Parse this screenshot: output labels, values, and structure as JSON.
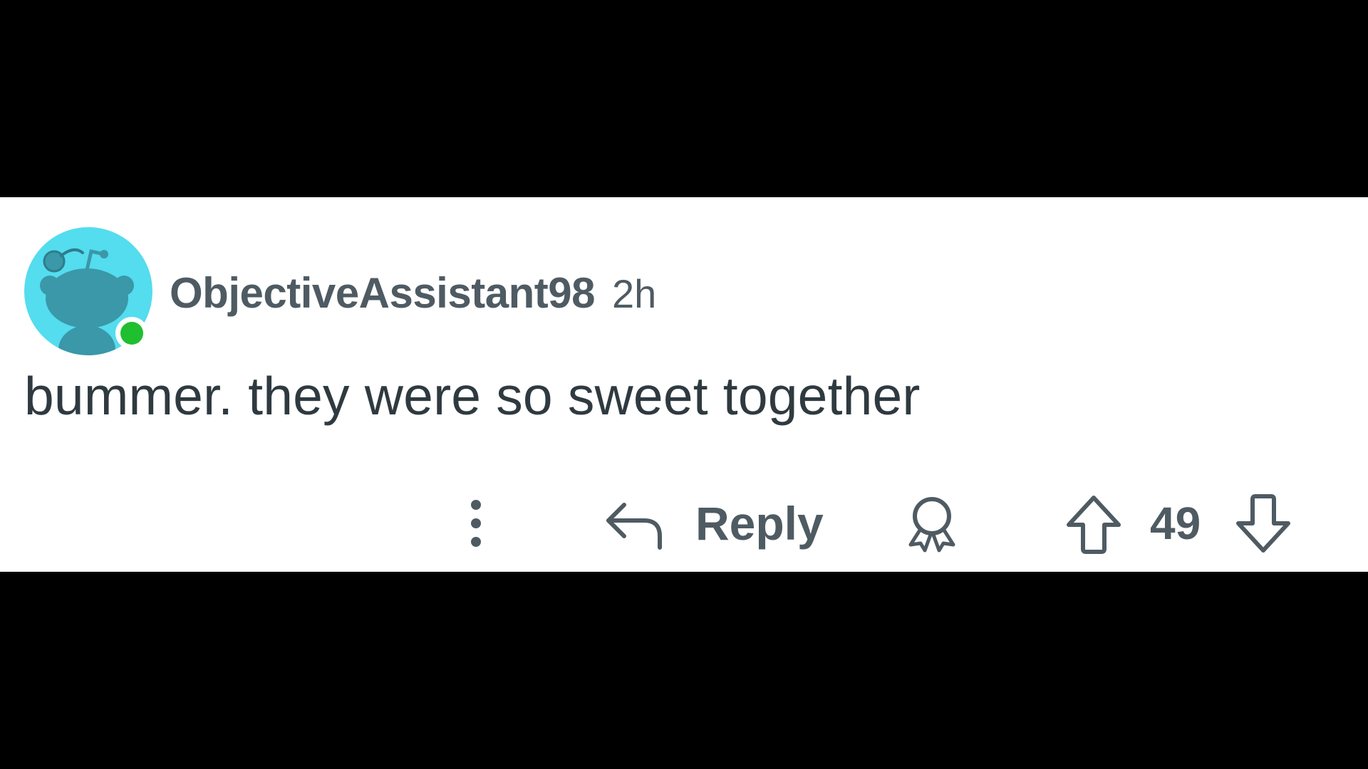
{
  "comment": {
    "username": "ObjectiveAssistant98",
    "timestamp": "2h",
    "body": "bummer. they were so sweet together",
    "online": true
  },
  "actions": {
    "more_icon": "vertical-dots-icon",
    "reply_icon": "reply-arrow-icon",
    "reply_label": "Reply",
    "award_icon": "award-icon",
    "upvote_icon": "upvote-arrow-icon",
    "vote_count": "49",
    "downvote_icon": "downvote-arrow-icon"
  },
  "colors": {
    "avatar_background": "#54dcef",
    "avatar_figure": "#3a98a8",
    "online_indicator": "#1fbf2f",
    "text_primary": "#2f3a40",
    "text_secondary": "#4f5b63",
    "card_background": "#ffffff",
    "letterbox": "#000000"
  }
}
